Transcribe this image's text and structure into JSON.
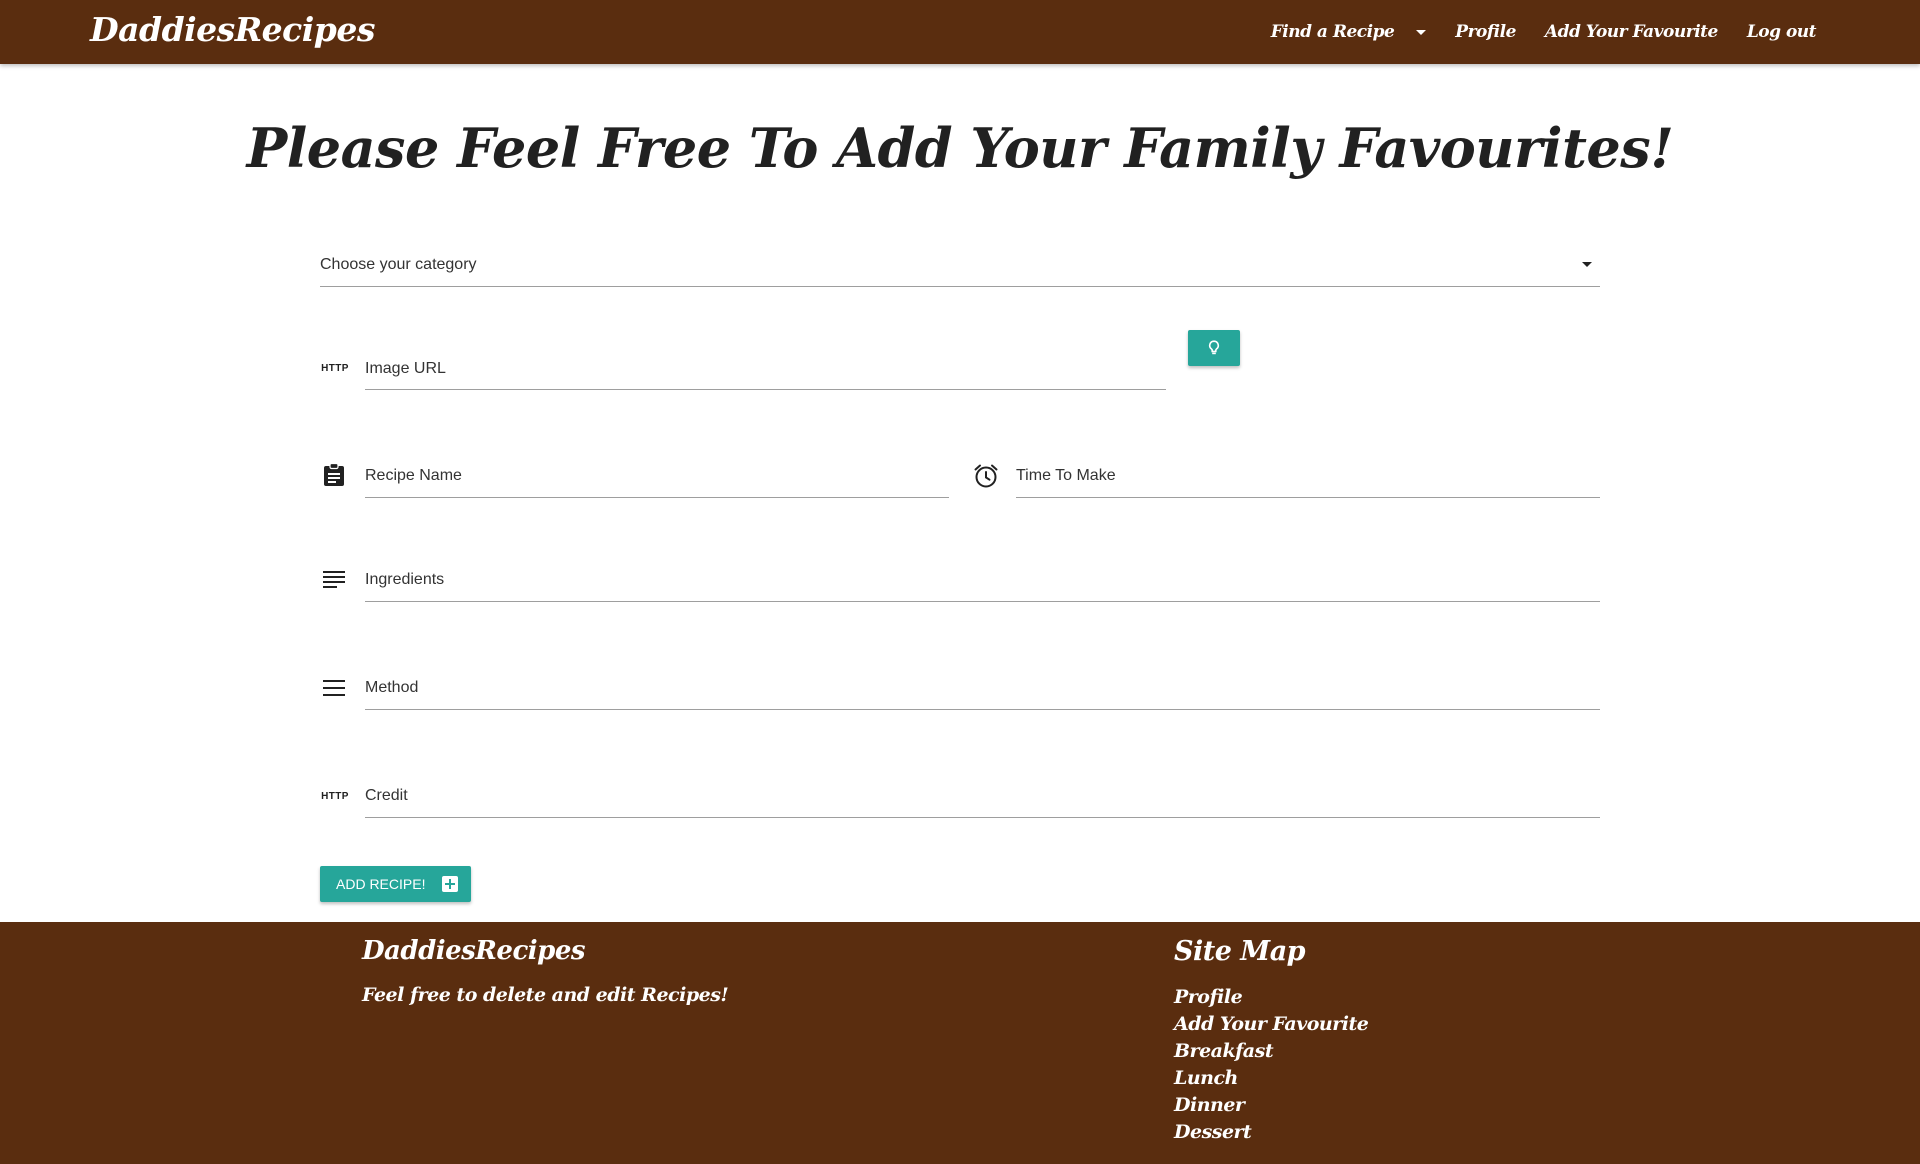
{
  "navbar": {
    "brand": "DaddiesRecipes",
    "links": [
      "Find a Recipe",
      "Profile",
      "Add Your Favourite",
      "Log out"
    ]
  },
  "page": {
    "title": "Please Feel Free To Add Your Family Favourites!"
  },
  "form": {
    "category_select": {
      "selected": "Choose your category",
      "icon": "chevron-down-icon"
    },
    "image_url": {
      "label": "Image URL",
      "icon_text": "HTTP"
    },
    "hint_button": {
      "icon": "lightbulb-icon"
    },
    "recipe_name": {
      "label": "Recipe Name",
      "icon": "clipboard-icon"
    },
    "time_to_make": {
      "label": "Time To Make",
      "icon": "alarm-clock-icon"
    },
    "ingredients": {
      "label": "Ingredients",
      "icon": "notes-icon"
    },
    "method": {
      "label": "Method",
      "icon": "menu-icon"
    },
    "credit": {
      "label": "Credit",
      "icon_text": "HTTP"
    },
    "submit": {
      "label": "ADD RECIPE!",
      "icon": "add-box-icon"
    }
  },
  "footer": {
    "brand": "DaddiesRecipes",
    "tagline": "Feel free to delete and edit Recipes!",
    "sitemap_title": "Site Map",
    "sitemap_links": [
      "Profile",
      "Add Your Favourite",
      "Breakfast",
      "Lunch",
      "Dinner",
      "Dessert"
    ]
  },
  "colors": {
    "brand_brown": "#5a2d0f",
    "accent_teal": "#26a69a"
  }
}
